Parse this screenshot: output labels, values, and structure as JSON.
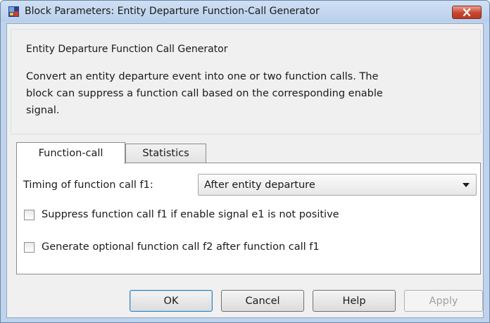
{
  "window": {
    "title": "Block Parameters: Entity Departure Function-Call Generator",
    "icons": {
      "app": "simulink-block-icon",
      "close": "close-icon"
    },
    "colors": {
      "accent": "#3c7fb1",
      "close_button": "#c8452f",
      "frame": "#bfd4ec"
    }
  },
  "description": {
    "group_title": "Entity Departure Function Call Generator",
    "text_lines": [
      "Convert an entity departure event into one or two function calls. The",
      "block can suppress a function call based on the corresponding enable",
      "signal."
    ]
  },
  "tabs": [
    {
      "label": "Function-call",
      "active": true
    },
    {
      "label": "Statistics",
      "active": false
    }
  ],
  "function_call_tab": {
    "timing_label": "Timing of function call f1:",
    "timing_value": "After entity departure",
    "checkboxes": [
      {
        "label": "Suppress function call f1 if enable signal e1 is not positive",
        "checked": false
      },
      {
        "label": "Generate optional function call f2 after function call f1",
        "checked": false
      }
    ]
  },
  "buttons": {
    "ok": "OK",
    "cancel": "Cancel",
    "help": "Help",
    "apply": "Apply"
  }
}
